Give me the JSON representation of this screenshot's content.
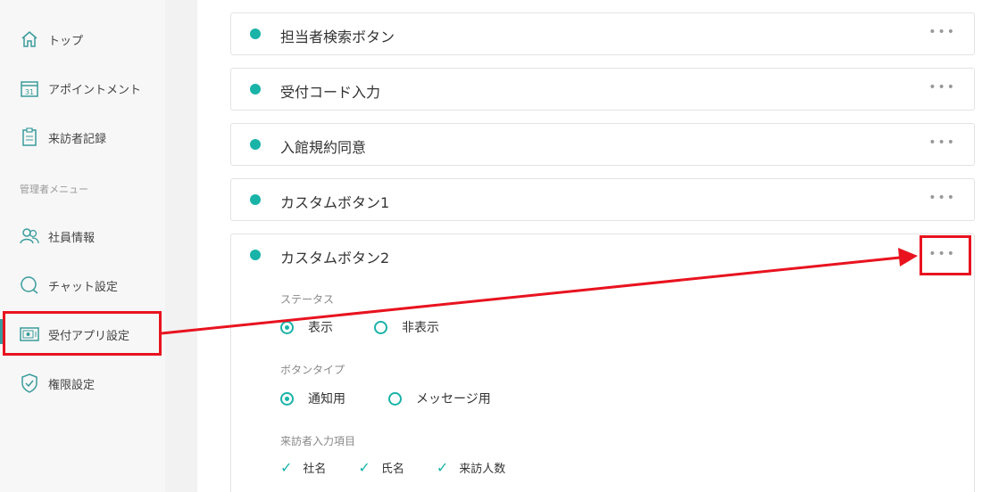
{
  "sidebar": {
    "items": [
      {
        "label": "トップ",
        "icon": "home-icon"
      },
      {
        "label": "アポイントメント",
        "icon": "calendar-icon"
      },
      {
        "label": "来訪者記録",
        "icon": "clipboard-icon"
      }
    ],
    "admin_section": "管理者メニュー",
    "admin_items": [
      {
        "label": "社員情報",
        "icon": "users-icon"
      },
      {
        "label": "チャット設定",
        "icon": "chat-icon"
      },
      {
        "label": "受付アプリ設定",
        "icon": "tablet-icon"
      },
      {
        "label": "権限設定",
        "icon": "shield-icon"
      }
    ]
  },
  "cards": [
    {
      "title": "担当者検索ボタン"
    },
    {
      "title": "受付コード入力"
    },
    {
      "title": "入館規約同意"
    },
    {
      "title": "カスタムボタン1"
    },
    {
      "title": "カスタムボタン2"
    }
  ],
  "more_label": "•••",
  "expanded": {
    "status_label": "ステータス",
    "status_options": [
      "表示",
      "非表示"
    ],
    "status_selected": "表示",
    "type_label": "ボタンタイプ",
    "type_options": [
      "通知用",
      "メッセージ用"
    ],
    "type_selected": "通知用",
    "fields_label": "来訪者入力項目",
    "fields": [
      "社名",
      "氏名",
      "来訪人数"
    ]
  },
  "colors": {
    "accent": "#1ab3a8",
    "annotation": "#e8131f"
  }
}
